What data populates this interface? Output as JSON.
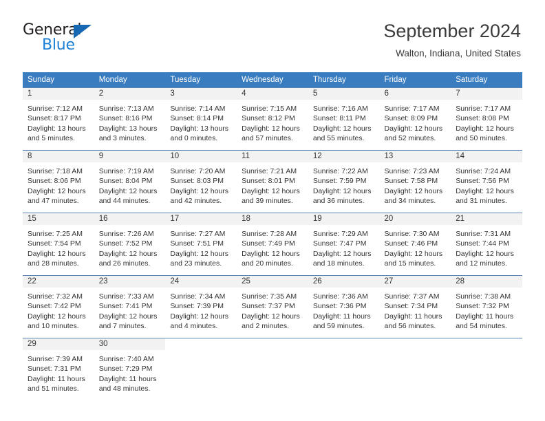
{
  "brand": {
    "name_part1": "General",
    "name_part2": "Blue",
    "accent_color": "#1668b3",
    "blue_text_color": "#1b7fd4"
  },
  "header": {
    "title": "September 2024",
    "subtitle": "Walton, Indiana, United States"
  },
  "theme": {
    "header_bar_color": "#3a7cc0",
    "day_band_color": "#f2f2f2",
    "row_rule_color": "#5a85b5"
  },
  "weekday_headers": [
    "Sunday",
    "Monday",
    "Tuesday",
    "Wednesday",
    "Thursday",
    "Friday",
    "Saturday"
  ],
  "labels": {
    "sunrise_prefix": "Sunrise:",
    "sunset_prefix": "Sunset:",
    "daylight_prefix": "Daylight:"
  },
  "weeks": [
    [
      {
        "day": "1",
        "sunrise": "Sunrise: 7:12 AM",
        "sunset": "Sunset: 8:17 PM",
        "daylight_line1": "Daylight: 13 hours",
        "daylight_line2": "and 5 minutes."
      },
      {
        "day": "2",
        "sunrise": "Sunrise: 7:13 AM",
        "sunset": "Sunset: 8:16 PM",
        "daylight_line1": "Daylight: 13 hours",
        "daylight_line2": "and 3 minutes."
      },
      {
        "day": "3",
        "sunrise": "Sunrise: 7:14 AM",
        "sunset": "Sunset: 8:14 PM",
        "daylight_line1": "Daylight: 13 hours",
        "daylight_line2": "and 0 minutes."
      },
      {
        "day": "4",
        "sunrise": "Sunrise: 7:15 AM",
        "sunset": "Sunset: 8:12 PM",
        "daylight_line1": "Daylight: 12 hours",
        "daylight_line2": "and 57 minutes."
      },
      {
        "day": "5",
        "sunrise": "Sunrise: 7:16 AM",
        "sunset": "Sunset: 8:11 PM",
        "daylight_line1": "Daylight: 12 hours",
        "daylight_line2": "and 55 minutes."
      },
      {
        "day": "6",
        "sunrise": "Sunrise: 7:17 AM",
        "sunset": "Sunset: 8:09 PM",
        "daylight_line1": "Daylight: 12 hours",
        "daylight_line2": "and 52 minutes."
      },
      {
        "day": "7",
        "sunrise": "Sunrise: 7:17 AM",
        "sunset": "Sunset: 8:08 PM",
        "daylight_line1": "Daylight: 12 hours",
        "daylight_line2": "and 50 minutes."
      }
    ],
    [
      {
        "day": "8",
        "sunrise": "Sunrise: 7:18 AM",
        "sunset": "Sunset: 8:06 PM",
        "daylight_line1": "Daylight: 12 hours",
        "daylight_line2": "and 47 minutes."
      },
      {
        "day": "9",
        "sunrise": "Sunrise: 7:19 AM",
        "sunset": "Sunset: 8:04 PM",
        "daylight_line1": "Daylight: 12 hours",
        "daylight_line2": "and 44 minutes."
      },
      {
        "day": "10",
        "sunrise": "Sunrise: 7:20 AM",
        "sunset": "Sunset: 8:03 PM",
        "daylight_line1": "Daylight: 12 hours",
        "daylight_line2": "and 42 minutes."
      },
      {
        "day": "11",
        "sunrise": "Sunrise: 7:21 AM",
        "sunset": "Sunset: 8:01 PM",
        "daylight_line1": "Daylight: 12 hours",
        "daylight_line2": "and 39 minutes."
      },
      {
        "day": "12",
        "sunrise": "Sunrise: 7:22 AM",
        "sunset": "Sunset: 7:59 PM",
        "daylight_line1": "Daylight: 12 hours",
        "daylight_line2": "and 36 minutes."
      },
      {
        "day": "13",
        "sunrise": "Sunrise: 7:23 AM",
        "sunset": "Sunset: 7:58 PM",
        "daylight_line1": "Daylight: 12 hours",
        "daylight_line2": "and 34 minutes."
      },
      {
        "day": "14",
        "sunrise": "Sunrise: 7:24 AM",
        "sunset": "Sunset: 7:56 PM",
        "daylight_line1": "Daylight: 12 hours",
        "daylight_line2": "and 31 minutes."
      }
    ],
    [
      {
        "day": "15",
        "sunrise": "Sunrise: 7:25 AM",
        "sunset": "Sunset: 7:54 PM",
        "daylight_line1": "Daylight: 12 hours",
        "daylight_line2": "and 28 minutes."
      },
      {
        "day": "16",
        "sunrise": "Sunrise: 7:26 AM",
        "sunset": "Sunset: 7:52 PM",
        "daylight_line1": "Daylight: 12 hours",
        "daylight_line2": "and 26 minutes."
      },
      {
        "day": "17",
        "sunrise": "Sunrise: 7:27 AM",
        "sunset": "Sunset: 7:51 PM",
        "daylight_line1": "Daylight: 12 hours",
        "daylight_line2": "and 23 minutes."
      },
      {
        "day": "18",
        "sunrise": "Sunrise: 7:28 AM",
        "sunset": "Sunset: 7:49 PM",
        "daylight_line1": "Daylight: 12 hours",
        "daylight_line2": "and 20 minutes."
      },
      {
        "day": "19",
        "sunrise": "Sunrise: 7:29 AM",
        "sunset": "Sunset: 7:47 PM",
        "daylight_line1": "Daylight: 12 hours",
        "daylight_line2": "and 18 minutes."
      },
      {
        "day": "20",
        "sunrise": "Sunrise: 7:30 AM",
        "sunset": "Sunset: 7:46 PM",
        "daylight_line1": "Daylight: 12 hours",
        "daylight_line2": "and 15 minutes."
      },
      {
        "day": "21",
        "sunrise": "Sunrise: 7:31 AM",
        "sunset": "Sunset: 7:44 PM",
        "daylight_line1": "Daylight: 12 hours",
        "daylight_line2": "and 12 minutes."
      }
    ],
    [
      {
        "day": "22",
        "sunrise": "Sunrise: 7:32 AM",
        "sunset": "Sunset: 7:42 PM",
        "daylight_line1": "Daylight: 12 hours",
        "daylight_line2": "and 10 minutes."
      },
      {
        "day": "23",
        "sunrise": "Sunrise: 7:33 AM",
        "sunset": "Sunset: 7:41 PM",
        "daylight_line1": "Daylight: 12 hours",
        "daylight_line2": "and 7 minutes."
      },
      {
        "day": "24",
        "sunrise": "Sunrise: 7:34 AM",
        "sunset": "Sunset: 7:39 PM",
        "daylight_line1": "Daylight: 12 hours",
        "daylight_line2": "and 4 minutes."
      },
      {
        "day": "25",
        "sunrise": "Sunrise: 7:35 AM",
        "sunset": "Sunset: 7:37 PM",
        "daylight_line1": "Daylight: 12 hours",
        "daylight_line2": "and 2 minutes."
      },
      {
        "day": "26",
        "sunrise": "Sunrise: 7:36 AM",
        "sunset": "Sunset: 7:36 PM",
        "daylight_line1": "Daylight: 11 hours",
        "daylight_line2": "and 59 minutes."
      },
      {
        "day": "27",
        "sunrise": "Sunrise: 7:37 AM",
        "sunset": "Sunset: 7:34 PM",
        "daylight_line1": "Daylight: 11 hours",
        "daylight_line2": "and 56 minutes."
      },
      {
        "day": "28",
        "sunrise": "Sunrise: 7:38 AM",
        "sunset": "Sunset: 7:32 PM",
        "daylight_line1": "Daylight: 11 hours",
        "daylight_line2": "and 54 minutes."
      }
    ],
    [
      {
        "day": "29",
        "sunrise": "Sunrise: 7:39 AM",
        "sunset": "Sunset: 7:31 PM",
        "daylight_line1": "Daylight: 11 hours",
        "daylight_line2": "and 51 minutes."
      },
      {
        "day": "30",
        "sunrise": "Sunrise: 7:40 AM",
        "sunset": "Sunset: 7:29 PM",
        "daylight_line1": "Daylight: 11 hours",
        "daylight_line2": "and 48 minutes."
      },
      {
        "day": "",
        "sunrise": "",
        "sunset": "",
        "daylight_line1": "",
        "daylight_line2": ""
      },
      {
        "day": "",
        "sunrise": "",
        "sunset": "",
        "daylight_line1": "",
        "daylight_line2": ""
      },
      {
        "day": "",
        "sunrise": "",
        "sunset": "",
        "daylight_line1": "",
        "daylight_line2": ""
      },
      {
        "day": "",
        "sunrise": "",
        "sunset": "",
        "daylight_line1": "",
        "daylight_line2": ""
      },
      {
        "day": "",
        "sunrise": "",
        "sunset": "",
        "daylight_line1": "",
        "daylight_line2": ""
      }
    ]
  ]
}
